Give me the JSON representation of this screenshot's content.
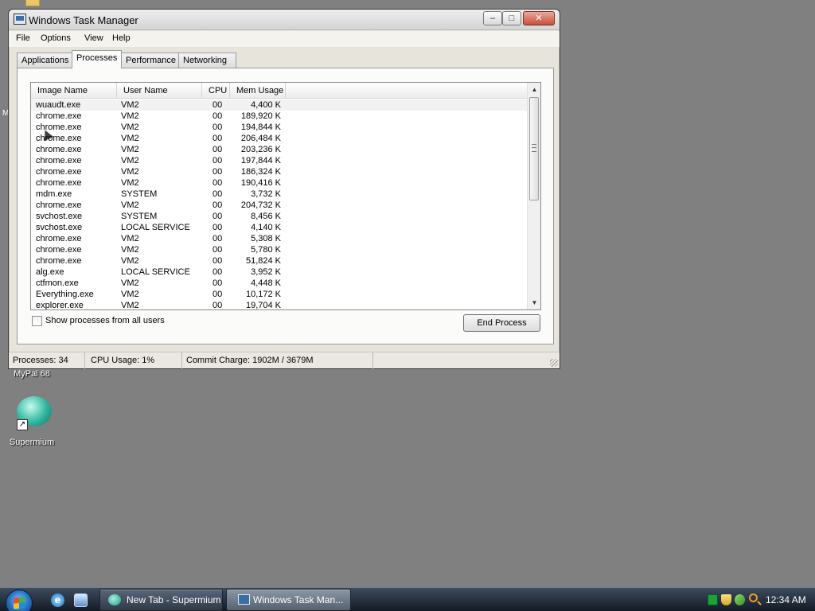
{
  "desktop": {
    "icons": [
      {
        "label": "MyPal 68"
      },
      {
        "label": "Supermium"
      }
    ]
  },
  "window": {
    "title": "Windows Task Manager",
    "controls": {
      "minimize": "–",
      "maximize": "□",
      "close": "✕"
    }
  },
  "menubar": {
    "items": [
      "File",
      "Options",
      "View",
      "Help"
    ]
  },
  "tabs": [
    {
      "label": "Applications",
      "active": false
    },
    {
      "label": "Processes",
      "active": true
    },
    {
      "label": "Performance",
      "active": false
    },
    {
      "label": "Networking",
      "active": false
    }
  ],
  "process_table": {
    "columns": [
      "Image Name",
      "User Name",
      "CPU",
      "Mem Usage"
    ],
    "rows": [
      [
        "wuaudt.exe",
        "VM2",
        "00",
        "4,400 K"
      ],
      [
        "chrome.exe",
        "VM2",
        "00",
        "189,920 K"
      ],
      [
        "chrome.exe",
        "VM2",
        "00",
        "194,844 K"
      ],
      [
        "chrome.exe",
        "VM2",
        "00",
        "206,484 K"
      ],
      [
        "chrome.exe",
        "VM2",
        "00",
        "203,236 K"
      ],
      [
        "chrome.exe",
        "VM2",
        "00",
        "197,844 K"
      ],
      [
        "chrome.exe",
        "VM2",
        "00",
        "186,324 K"
      ],
      [
        "chrome.exe",
        "VM2",
        "00",
        "190,416 K"
      ],
      [
        "mdm.exe",
        "SYSTEM",
        "00",
        "3,732 K"
      ],
      [
        "chrome.exe",
        "VM2",
        "00",
        "204,732 K"
      ],
      [
        "svchost.exe",
        "SYSTEM",
        "00",
        "8,456 K"
      ],
      [
        "svchost.exe",
        "LOCAL SERVICE",
        "00",
        "4,140 K"
      ],
      [
        "chrome.exe",
        "VM2",
        "00",
        "5,308 K"
      ],
      [
        "chrome.exe",
        "VM2",
        "00",
        "5,780 K"
      ],
      [
        "chrome.exe",
        "VM2",
        "00",
        "51,824 K"
      ],
      [
        "alg.exe",
        "LOCAL SERVICE",
        "00",
        "3,952 K"
      ],
      [
        "ctfmon.exe",
        "VM2",
        "00",
        "4,448 K"
      ],
      [
        "Everything.exe",
        "VM2",
        "00",
        "10,172 K"
      ],
      [
        "explorer.exe",
        "VM2",
        "00",
        "19,704 K"
      ]
    ]
  },
  "show_all_users": {
    "label": "Show processes from all users",
    "checked": false
  },
  "end_process_label": "End Process",
  "statusbar": {
    "processes": "Processes: 34",
    "cpu_usage": "CPU Usage: 1%",
    "commit_charge": "Commit Charge: 1902M / 3679M"
  },
  "taskbar": {
    "quick_launch": [
      {
        "icon": "internet-explorer-icon",
        "glyph": "e"
      },
      {
        "icon": "show-desktop-icon"
      }
    ],
    "buttons": [
      {
        "label": "New Tab - Supermium",
        "active": false,
        "icon": "supermium-icon"
      },
      {
        "label": "Windows Task Man...",
        "active": true,
        "icon": "task-manager-icon"
      }
    ],
    "clock": "12:34 AM"
  }
}
